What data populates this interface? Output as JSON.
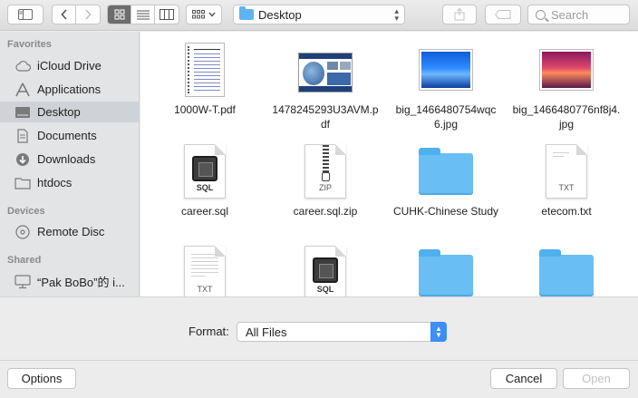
{
  "toolbar": {
    "location": "Desktop",
    "search_placeholder": "Search",
    "view_modes": [
      "icon-view",
      "list-view",
      "column-view"
    ]
  },
  "sidebar": {
    "sections": [
      {
        "title": "Favorites",
        "items": [
          {
            "label": "iCloud Drive",
            "icon": "cloud-icon"
          },
          {
            "label": "Applications",
            "icon": "applications-icon"
          },
          {
            "label": "Desktop",
            "icon": "desktop-icon",
            "selected": true
          },
          {
            "label": "Documents",
            "icon": "documents-icon"
          },
          {
            "label": "Downloads",
            "icon": "downloads-icon"
          },
          {
            "label": "htdocs",
            "icon": "folder-icon"
          }
        ]
      },
      {
        "title": "Devices",
        "items": [
          {
            "label": "Remote Disc",
            "icon": "disc-icon"
          }
        ]
      },
      {
        "title": "Shared",
        "items": [
          {
            "label": "“Pak BoBo”的 i...",
            "icon": "computer-icon"
          }
        ]
      }
    ]
  },
  "files": [
    {
      "name": "1000W-T.pdf",
      "kind": "pdf"
    },
    {
      "name": "1478245293U3AVM.pdf",
      "kind": "pdf-image"
    },
    {
      "name": "big_1466480754wqc6.jpg",
      "kind": "jpg-blue"
    },
    {
      "name": "big_1466480776nf8j4.jpg",
      "kind": "jpg-sunset"
    },
    {
      "name": "career.sql",
      "kind": "sql",
      "tag": "SQL"
    },
    {
      "name": "career.sql.zip",
      "kind": "zip",
      "tag": "ZIP"
    },
    {
      "name": "CUHK-Chinese Study",
      "kind": "folder"
    },
    {
      "name": "etecom.txt",
      "kind": "txt",
      "tag": "TXT"
    },
    {
      "name": "",
      "kind": "txt",
      "tag": "TXT"
    },
    {
      "name": "",
      "kind": "sql",
      "tag": "SQL"
    },
    {
      "name": "",
      "kind": "folder"
    },
    {
      "name": "",
      "kind": "folder"
    }
  ],
  "format": {
    "label": "Format:",
    "value": "All Files"
  },
  "buttons": {
    "options": "Options",
    "cancel": "Cancel",
    "open": "Open"
  },
  "colors": {
    "folder": "#69bff3",
    "accent": "#3d8ef7",
    "sidebar_bg": "#e3e4e6",
    "selected_bg": "#cfd2d6"
  }
}
